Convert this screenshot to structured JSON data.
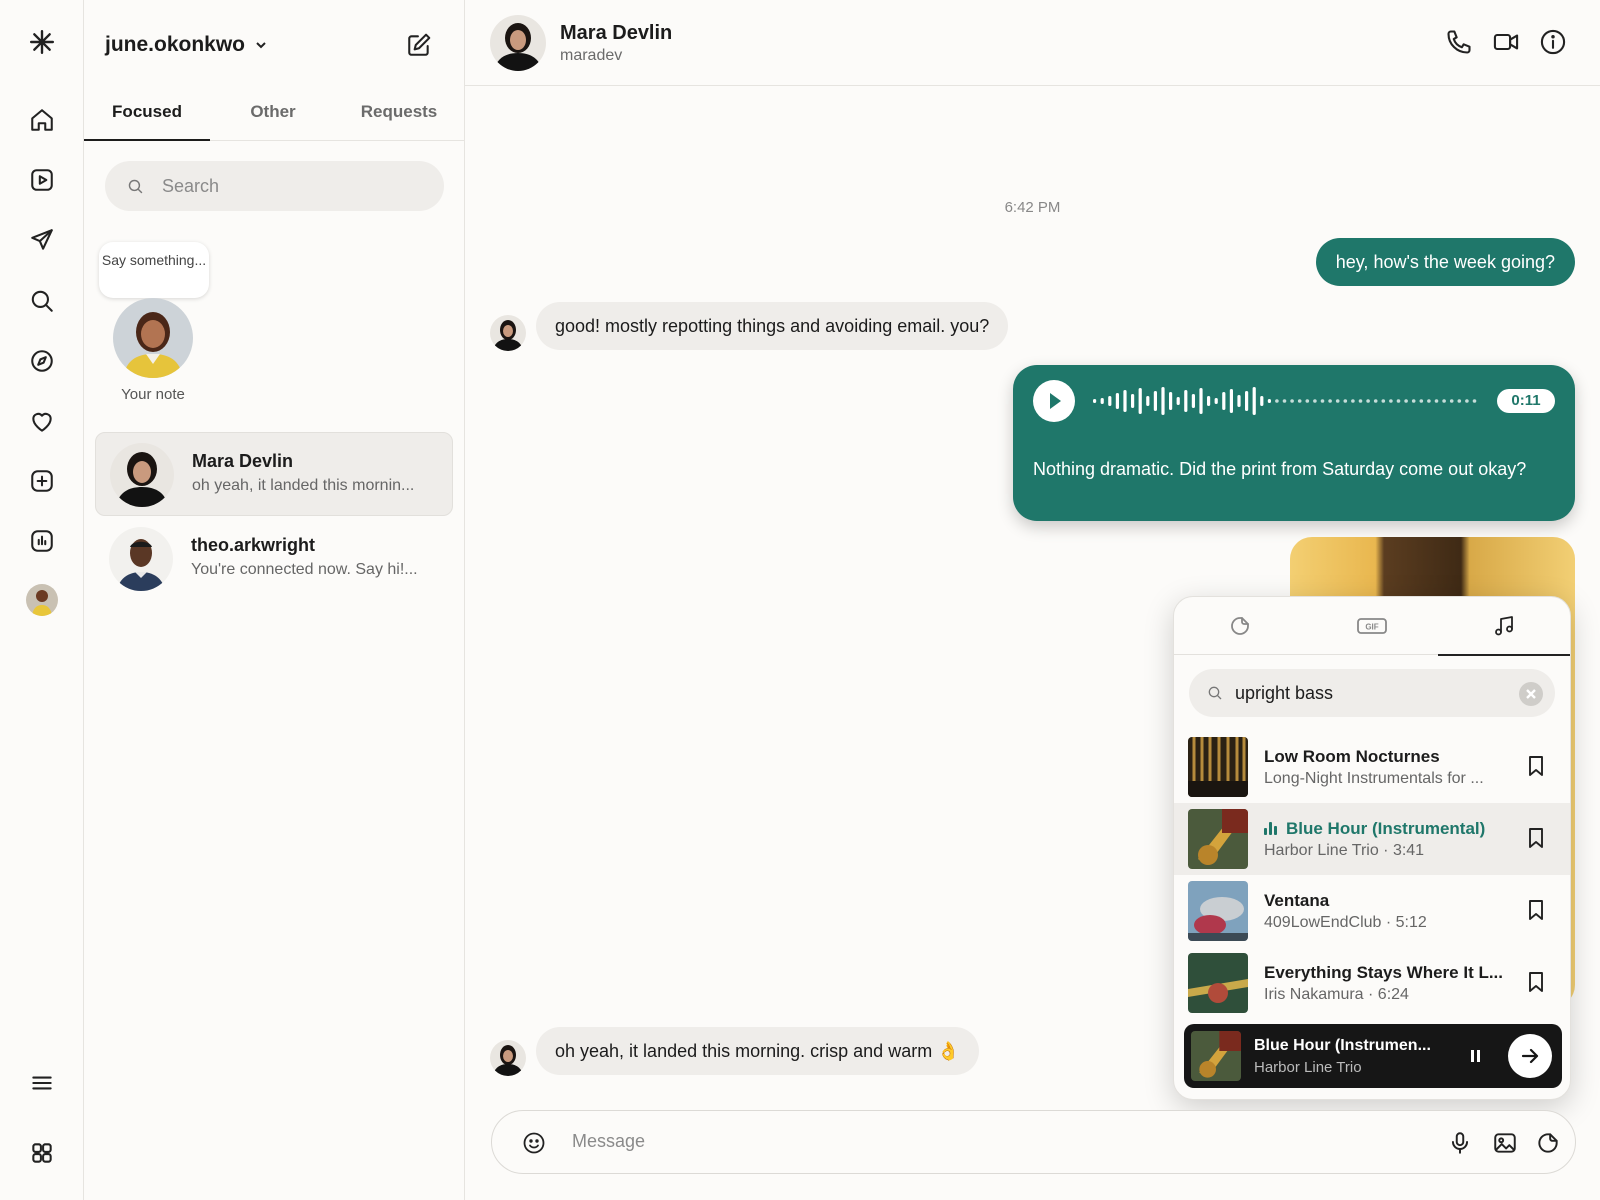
{
  "sidebar": {
    "account_name": "june.okonkwo",
    "tabs": [
      {
        "label": "Focused",
        "active": true
      },
      {
        "label": "Other",
        "active": false
      },
      {
        "label": "Requests",
        "active": false
      }
    ],
    "search_placeholder": "Search",
    "note": {
      "bubble_text": "Say something...",
      "label": "Your note"
    },
    "threads": [
      {
        "name": "Mara Devlin",
        "preview": "oh yeah, it landed this mornin...",
        "selected": true
      },
      {
        "name": "theo.arkwright",
        "preview": "You're connected now. Say hi!...",
        "selected": false
      }
    ]
  },
  "rail": {
    "icons": [
      "logo-icon",
      "home-icon",
      "reels-icon",
      "send-icon",
      "search-icon",
      "explore-icon",
      "heart-icon",
      "create-icon",
      "insights-icon",
      "profile-avatar",
      "menu-icon",
      "apps-icon"
    ]
  },
  "chat": {
    "contact_name": "Mara Devlin",
    "contact_username": "maradev",
    "timestamp": "6:42 PM",
    "messages": [
      {
        "from": "me",
        "text": "hey, how's the week going?"
      },
      {
        "from": "them",
        "text": "good! mostly repotting things and avoiding email. you?"
      },
      {
        "from": "me",
        "type": "voice",
        "duration": "0:11",
        "transcript": "Nothing dramatic. Did the print from Saturday come out okay?"
      },
      {
        "from": "them",
        "text": "oh yeah, it landed this morning. crisp and warm 👌"
      }
    ],
    "composer_placeholder": "Message"
  },
  "music_picker": {
    "tabs": [
      "sticker-tab",
      "gif-tab",
      "music-tab"
    ],
    "gif_label": "GIF",
    "active_tab": "music-tab",
    "search_value": "upright bass",
    "tracks": [
      {
        "title": "Low Room Nocturnes",
        "subtitle": "Long-Night Instrumentals for ...",
        "playing": false
      },
      {
        "title": "Blue Hour (Instrumental)",
        "subtitle": "Harbor Line Trio · 3:41",
        "playing": true
      },
      {
        "title": "Ventana",
        "subtitle": "409LowEndClub · 5:12",
        "playing": false
      },
      {
        "title": "Everything Stays Where It L...",
        "subtitle": "Iris Nakamura · 6:24",
        "playing": false
      }
    ],
    "now_playing": {
      "title": "Blue Hour (Instrumen...",
      "artist": "Harbor Line Trio"
    }
  },
  "colors": {
    "accent": "#1f776a",
    "bubble_in": "#efedea",
    "background": "#fcfbf9"
  }
}
